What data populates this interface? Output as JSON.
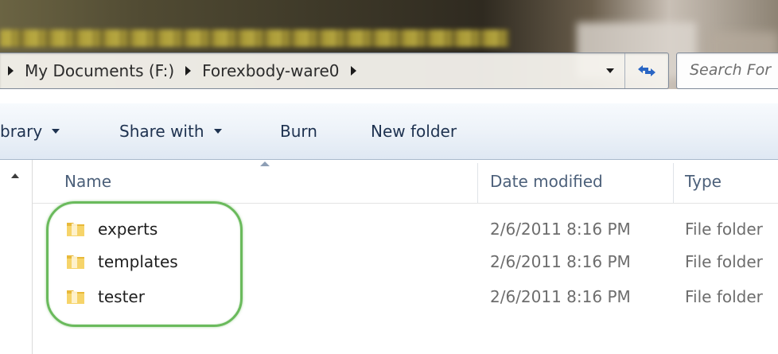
{
  "address_bar": {
    "crumbs": [
      "My Documents (F:)",
      "Forexbody-ware0"
    ]
  },
  "search": {
    "placeholder": "Search For"
  },
  "toolbar": {
    "library_label": "brary",
    "share_label": "Share with",
    "burn_label": "Burn",
    "new_folder_label": "New folder"
  },
  "columns": {
    "name": "Name",
    "date_modified": "Date modified",
    "type": "Type"
  },
  "files": [
    {
      "name": "experts",
      "date": "2/6/2011 8:16 PM",
      "type": "File folder"
    },
    {
      "name": "templates",
      "date": "2/6/2011 8:16 PM",
      "type": "File folder"
    },
    {
      "name": "tester",
      "date": "2/6/2011 8:16 PM",
      "type": "File folder"
    }
  ],
  "icons": {
    "crumb_separator": "chevron-right-icon",
    "address_dropdown": "chevron-down-icon",
    "refresh": "refresh-icon",
    "folder": "folder-icon",
    "scroll_up": "scroll-up-arrow-icon"
  },
  "colors": {
    "highlight": "#6aba5c",
    "toolbar_text": "#1e3250",
    "header_text": "#4c607a"
  }
}
